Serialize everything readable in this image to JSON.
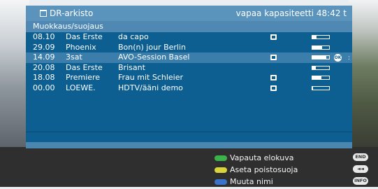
{
  "header": {
    "title": "DR-arkisto",
    "capacity": "vapaa kapasiteetti 48:42 t",
    "title_icon": "archive-tab-icon"
  },
  "subheader": {
    "label": "Muokkaus/suojaus"
  },
  "recordings": [
    {
      "time": "08.10",
      "channel": "Das Erste",
      "title": "da capo",
      "icon": "play-icon",
      "progress": 0.25
    },
    {
      "time": "29.09",
      "channel": "Phoenix",
      "title": "Bon(n) jour Berlin",
      "icon": "",
      "progress": 0.6
    },
    {
      "time": "14.09",
      "channel": "3sat",
      "title": "AVO-Session Basel",
      "icon": "lock-icon",
      "progress": 0.85,
      "selected": true
    },
    {
      "time": "20.08",
      "channel": "Das Erste",
      "title": "Brisant",
      "icon": "",
      "progress": 0.2
    },
    {
      "time": "18.08",
      "channel": "Premiere",
      "title": "Frau mit Schleier",
      "icon": "key-icon",
      "progress": 0.55
    },
    {
      "time": "00.00",
      "channel": "LOEWE.",
      "title": "HDTV/ääni demo",
      "icon": "folder-icon",
      "progress": 0.05
    }
  ],
  "selected_badge": "OK",
  "legend": [
    {
      "color": "#3cb34a",
      "label": "Vapauta elokuva",
      "key": "END"
    },
    {
      "color": "#d8d43a",
      "label": "Aseta poistosuoja",
      "key": "◄◄"
    },
    {
      "color": "#3a73c9",
      "label": "Muuta nimi",
      "key": "INFO"
    }
  ]
}
